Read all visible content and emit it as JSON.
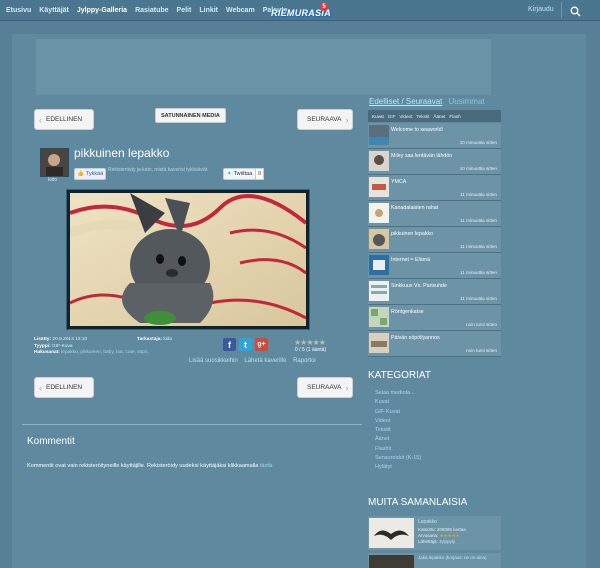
{
  "topnav": {
    "items": [
      "Etusivu",
      "Käyttäjät",
      "Jylppy-Galleria",
      "Rasiatube",
      "Pelit",
      "Linkit",
      "Webcam",
      "Palaute"
    ],
    "active_index": 2,
    "login": "Kirjaudu"
  },
  "logo": {
    "text": "RIEMURASIA",
    "badge": "5"
  },
  "nav": {
    "prev": "EDELLINEN",
    "next": "SEURAAVA",
    "random": "SATUNNAINEN MEDIA"
  },
  "media": {
    "title": "pikkuinen lepakko",
    "uploader": "kido",
    "fb_like": "Tykkää",
    "fb_text": "Rekisteröidy ja kato, mistä kaverisi tykkäävät.",
    "tweet": "Twiittaa",
    "tweet_count": "0",
    "added_label": "Lisätty:",
    "added_value": "20.9.2013 13:10",
    "type_label": "Tyyppi:",
    "type_value": "GIF-Kuva",
    "keywords_label": "Hakusanat:",
    "keywords": "lepakko, pikkuinen, baby, bat, cute, söpö,",
    "checker_label": "Tarkastaja:",
    "checker_value": "kido",
    "rating_text": "0 / 5 (1 ääntä)",
    "actions": [
      "Lisää suosikkeihin",
      "Lähetä kaverille",
      "Raportoi"
    ]
  },
  "comments": {
    "title": "Kommentit",
    "info": "Kommentit ovat vain rekisteröityneille käyttäjille. Rekisteröidy uudeksi käyttäjäksi klikkaamalla",
    "link": "tästä."
  },
  "sidebar": {
    "tab1": "Edelliset / Seuraavat",
    "tab2": "Uusimmat",
    "subtabs": [
      "Kuvat",
      "GIF",
      "Videot",
      "Tekstit",
      "Äänet",
      "Flash"
    ],
    "items": [
      {
        "name": "Welcome to seaworld!",
        "time": "10 minuuttia sitten"
      },
      {
        "name": "Miley saa lentävän lähdön",
        "time": "10 minuuttia sitten"
      },
      {
        "name": "YMCA",
        "time": "11 minuuttia sitten"
      },
      {
        "name": "Kanadalaisten rahat",
        "time": "11 minuuttia sitten"
      },
      {
        "name": "pikkuinen lepakko",
        "time": "11 minuuttia sitten"
      },
      {
        "name": "Internet = Elämä",
        "time": "11 minuuttia sitten"
      },
      {
        "name": "Sinkkuus Vs. Parisuhde",
        "time": "11 minuuttia sitten"
      },
      {
        "name": "Röntgenkatse",
        "time": "noin tunti sitten"
      },
      {
        "name": "Päivän söpöilyannos",
        "time": "noin tunti sitten"
      }
    ],
    "categories_title": "KATEGORIAT",
    "categories": [
      "Selaa mediota...",
      "Kuvat",
      "GIF-Kuvat",
      "Videot",
      "Tekstit",
      "Äänet",
      "Flashit",
      "Sensuroidut (K-15)",
      "Hylätyt"
    ],
    "related_title": "MUITA SAMANLAISIA",
    "related": [
      {
        "title": "Lepakko",
        "l1": "Katsottu: 208095 kertaa",
        "l2": "Arvosana:",
        "l3": "Lähettäjä:",
        "l3v": "Jylppyly"
      },
      {
        "title": "Jaka lepakko (korjaus: ne on aina)"
      }
    ]
  },
  "colors": {
    "bg": "#587f95",
    "topbar": "#4b7690",
    "link": "#a8d6f2",
    "facebook": "#3b5998",
    "twitter": "#2fa4d8",
    "gplus": "#d34836"
  }
}
